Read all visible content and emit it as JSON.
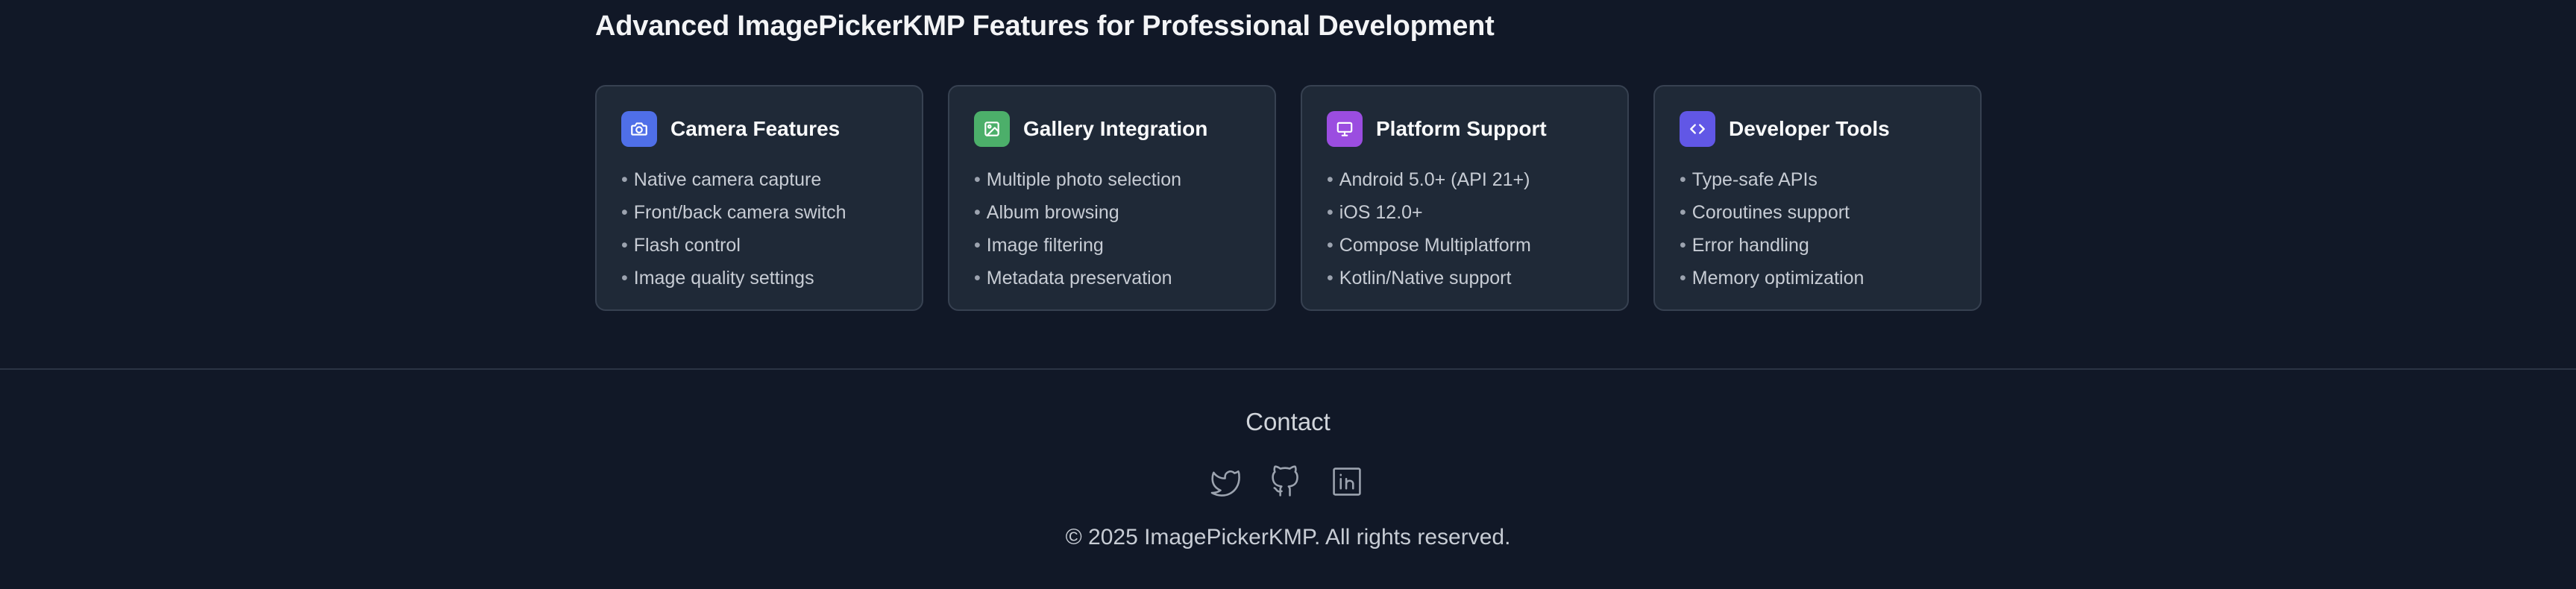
{
  "features": {
    "title": "Advanced ImagePickerKMP Features for Professional Development",
    "cards": [
      {
        "icon": "camera-icon",
        "icon_color": "#4f6fe8",
        "title": "Camera Features",
        "items": [
          "Native camera capture",
          "Front/back camera switch",
          "Flash control",
          "Image quality settings"
        ]
      },
      {
        "icon": "image-icon",
        "icon_color": "#4caf6a",
        "title": "Gallery Integration",
        "items": [
          "Multiple photo selection",
          "Album browsing",
          "Image filtering",
          "Metadata preservation"
        ]
      },
      {
        "icon": "monitor-icon",
        "icon_color": "#9b4de0",
        "title": "Platform Support",
        "items": [
          "Android 5.0+ (API 21+)",
          "iOS 12.0+",
          "Compose Multiplatform",
          "Kotlin/Native support"
        ]
      },
      {
        "icon": "code-icon",
        "icon_color": "#6157e6",
        "title": "Developer Tools",
        "items": [
          "Type-safe APIs",
          "Coroutines support",
          "Error handling",
          "Memory optimization"
        ]
      }
    ],
    "bullet": "•"
  },
  "footer": {
    "contact_label": "Contact",
    "socials": [
      "twitter-icon",
      "github-icon",
      "linkedin-icon"
    ],
    "copyright": "© 2025 ImagePickerKMP. All rights reserved."
  }
}
